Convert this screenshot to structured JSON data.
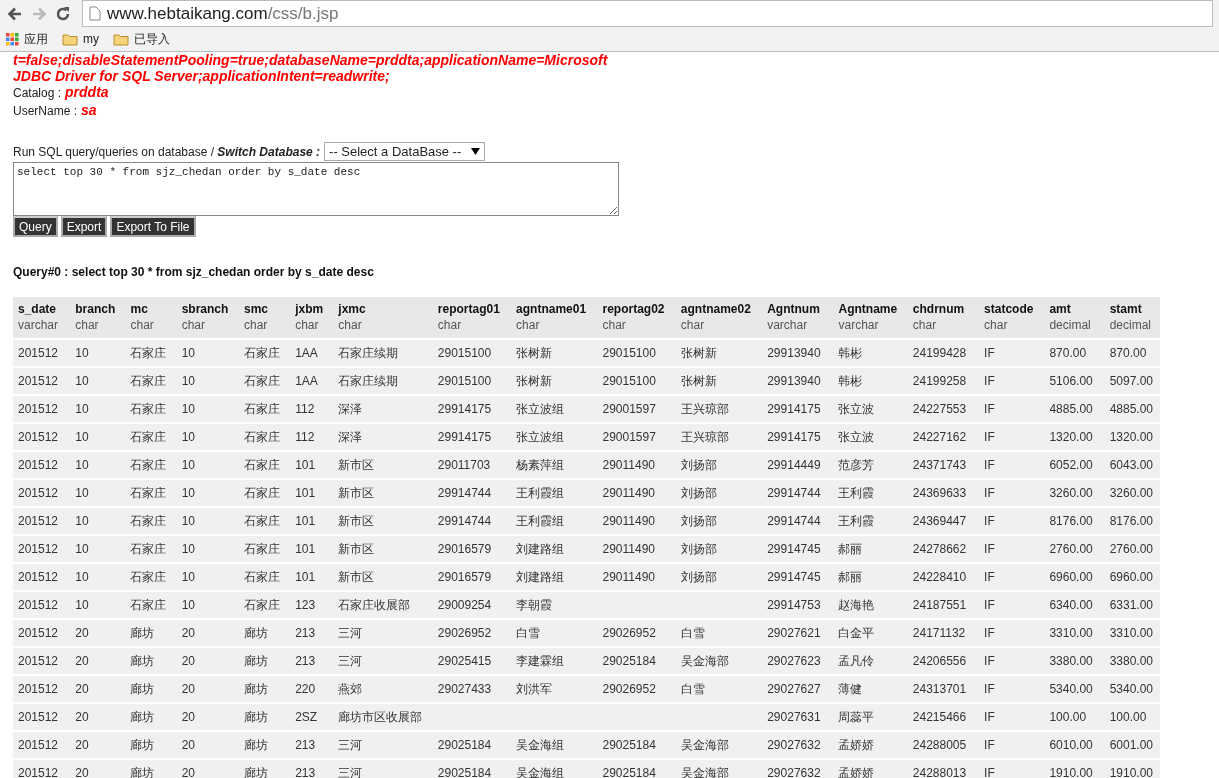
{
  "browser": {
    "back_enabled": true,
    "forward_enabled": false,
    "url_host": "www.hebtaikang.com",
    "url_path": "/css/b.jsp",
    "bookmarks": [
      {
        "kind": "apps",
        "label": "应用"
      },
      {
        "kind": "folder",
        "label": "my"
      },
      {
        "kind": "folder",
        "label": "已导入"
      }
    ]
  },
  "connection": {
    "lines": [
      "t=false;disableStatementPooling=true;databaseName=prddta;applicationName=Microsoft",
      "JDBC Driver for SQL Server;applicationIntent=readwrite;"
    ],
    "catalog_label": "Catalog :",
    "catalog": "prddta",
    "username_label": "UserName :",
    "username": "sa"
  },
  "query_form": {
    "prompt": "Run SQL query/queries on database / ",
    "switch_label": "Switch Database :",
    "database_select": "-- Select a DataBase --",
    "query": "select top 30 * from sjz_chedan order by s_date desc",
    "buttons": [
      "Query",
      "Export",
      "Export To File"
    ]
  },
  "result_title": "Query#0 : select top 30 * from sjz_chedan order by s_date desc",
  "table": {
    "columns": [
      {
        "name": "s_date",
        "type": "varchar"
      },
      {
        "name": "branch",
        "type": "char"
      },
      {
        "name": "mc",
        "type": "char"
      },
      {
        "name": "sbranch",
        "type": "char"
      },
      {
        "name": "smc",
        "type": "char"
      },
      {
        "name": "jxbm",
        "type": "char"
      },
      {
        "name": "jxmc",
        "type": "char"
      },
      {
        "name": "reportag01",
        "type": "char"
      },
      {
        "name": "agntname01",
        "type": "char"
      },
      {
        "name": "reportag02",
        "type": "char"
      },
      {
        "name": "agntname02",
        "type": "char"
      },
      {
        "name": "Agntnum",
        "type": "varchar"
      },
      {
        "name": "Agntname",
        "type": "varchar"
      },
      {
        "name": "chdrnum",
        "type": "char"
      },
      {
        "name": "statcode",
        "type": "char"
      },
      {
        "name": "amt",
        "type": "decimal"
      },
      {
        "name": "stamt",
        "type": "decimal"
      }
    ],
    "rows": [
      [
        "201512",
        "10",
        "石家庄",
        "10",
        "石家庄",
        "1AA",
        "石家庄续期",
        "29015100",
        "张树新",
        "29015100",
        "张树新",
        "29913940",
        "韩彬",
        "24199428",
        "IF",
        "870.00",
        "870.00"
      ],
      [
        "201512",
        "10",
        "石家庄",
        "10",
        "石家庄",
        "1AA",
        "石家庄续期",
        "29015100",
        "张树新",
        "29015100",
        "张树新",
        "29913940",
        "韩彬",
        "24199258",
        "IF",
        "5106.00",
        "5097.00"
      ],
      [
        "201512",
        "10",
        "石家庄",
        "10",
        "石家庄",
        "112",
        "深泽",
        "29914175",
        "张立波组",
        "29001597",
        "王兴琼部",
        "29914175",
        "张立波",
        "24227553",
        "IF",
        "4885.00",
        "4885.00"
      ],
      [
        "201512",
        "10",
        "石家庄",
        "10",
        "石家庄",
        "112",
        "深泽",
        "29914175",
        "张立波组",
        "29001597",
        "王兴琼部",
        "29914175",
        "张立波",
        "24227162",
        "IF",
        "1320.00",
        "1320.00"
      ],
      [
        "201512",
        "10",
        "石家庄",
        "10",
        "石家庄",
        "101",
        "新市区",
        "29011703",
        "杨素萍组",
        "29011490",
        "刘扬部",
        "29914449",
        "范彦芳",
        "24371743",
        "IF",
        "6052.00",
        "6043.00"
      ],
      [
        "201512",
        "10",
        "石家庄",
        "10",
        "石家庄",
        "101",
        "新市区",
        "29914744",
        "王利霞组",
        "29011490",
        "刘扬部",
        "29914744",
        "王利霞",
        "24369633",
        "IF",
        "3260.00",
        "3260.00"
      ],
      [
        "201512",
        "10",
        "石家庄",
        "10",
        "石家庄",
        "101",
        "新市区",
        "29914744",
        "王利霞组",
        "29011490",
        "刘扬部",
        "29914744",
        "王利霞",
        "24369447",
        "IF",
        "8176.00",
        "8176.00"
      ],
      [
        "201512",
        "10",
        "石家庄",
        "10",
        "石家庄",
        "101",
        "新市区",
        "29016579",
        "刘建路组",
        "29011490",
        "刘扬部",
        "29914745",
        "郝丽",
        "24278662",
        "IF",
        "2760.00",
        "2760.00"
      ],
      [
        "201512",
        "10",
        "石家庄",
        "10",
        "石家庄",
        "101",
        "新市区",
        "29016579",
        "刘建路组",
        "29011490",
        "刘扬部",
        "29914745",
        "郝丽",
        "24228410",
        "IF",
        "6960.00",
        "6960.00"
      ],
      [
        "201512",
        "10",
        "石家庄",
        "10",
        "石家庄",
        "123",
        "石家庄收展部",
        "29009254",
        "李朝霞",
        null,
        null,
        "29914753",
        "赵海艳",
        "24187551",
        "IF",
        "6340.00",
        "6331.00"
      ],
      [
        "201512",
        "20",
        "廊坊",
        "20",
        "廊坊",
        "213",
        "三河",
        "29026952",
        "白雪",
        "29026952",
        "白雪",
        "29027621",
        "白金平",
        "24171132",
        "IF",
        "3310.00",
        "3310.00"
      ],
      [
        "201512",
        "20",
        "廊坊",
        "20",
        "廊坊",
        "213",
        "三河",
        "29025415",
        "李建霖组",
        "29025184",
        "吴金海部",
        "29027623",
        "孟凡伶",
        "24206556",
        "IF",
        "3380.00",
        "3380.00"
      ],
      [
        "201512",
        "20",
        "廊坊",
        "20",
        "廊坊",
        "220",
        "燕郊",
        "29027433",
        "刘洪军",
        "29026952",
        "白雪",
        "29027627",
        "薄健",
        "24313701",
        "IF",
        "5340.00",
        "5340.00"
      ],
      [
        "201512",
        "20",
        "廊坊",
        "20",
        "廊坊",
        "2SZ",
        "廊坊市区收展部",
        null,
        null,
        null,
        null,
        "29027631",
        "周蕊平",
        "24215466",
        "IF",
        "100.00",
        "100.00"
      ],
      [
        "201512",
        "20",
        "廊坊",
        "20",
        "廊坊",
        "213",
        "三河",
        "29025184",
        "吴金海组",
        "29025184",
        "吴金海部",
        "29027632",
        "孟娇娇",
        "24288005",
        "IF",
        "6010.00",
        "6001.00"
      ],
      [
        "201512",
        "20",
        "廊坊",
        "20",
        "廊坊",
        "213",
        "三河",
        "29025184",
        "吴金海组",
        "29025184",
        "吴金海部",
        "29027632",
        "孟娇娇",
        "24288013",
        "IF",
        "1910.00",
        "1910.00"
      ]
    ]
  }
}
